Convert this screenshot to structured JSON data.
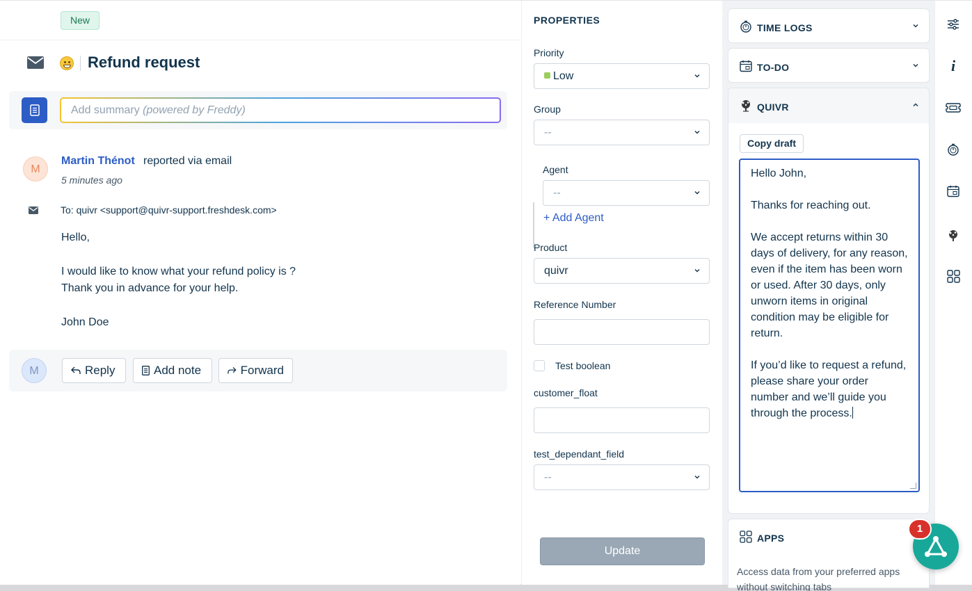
{
  "ticket": {
    "status": "New",
    "title": "Refund request",
    "summary_placeholder": "Add summary",
    "summary_powered": "(powered by Freddy)",
    "sender_initial": "M",
    "sender_name": "Martin Thénot",
    "via_text": "reported via email",
    "time": "5 minutes ago",
    "to_label": "To:",
    "to_value": "quivr <support@quivr-support.freshdesk.com>",
    "body": [
      "Hello,",
      "I would like to know what your refund policy is ?",
      "Thank you in advance for your help.",
      "John Doe"
    ],
    "me_initial": "M",
    "actions": {
      "reply": "Reply",
      "add_note": "Add note",
      "forward": "Forward"
    }
  },
  "properties": {
    "title": "PROPERTIES",
    "priority": {
      "label": "Priority",
      "value": "Low",
      "color": "#9cce5e"
    },
    "group": {
      "label": "Group",
      "value": "--"
    },
    "agent": {
      "label": "Agent",
      "value": "--",
      "add_label": "+ Add Agent"
    },
    "product": {
      "label": "Product",
      "value": "quivr"
    },
    "reference": {
      "label": "Reference Number",
      "value": ""
    },
    "test_boolean": {
      "label": "Test boolean"
    },
    "customer_float": {
      "label": "customer_float",
      "value": ""
    },
    "dependant": {
      "label": "test_dependant_field",
      "value": "--"
    },
    "update_label": "Update"
  },
  "widgets": {
    "time_logs": "TIME LOGS",
    "todo": "TO-DO",
    "quivr": {
      "title": "QUIVR",
      "copy_label": "Copy draft",
      "draft": "Hello John,\n\nThanks for reaching out.\n\nWe accept returns within 30 days of delivery, for any reason, even if the item has been worn or used. After 30 days, only unworn items in original condition may be eligible for return.\n\nIf you’d like to request a refund, please share your order number and we’ll guide you through the process."
    },
    "apps": {
      "title": "APPS",
      "desc": "Access data from your preferred apps without switching tabs"
    }
  },
  "fab_badge": "1",
  "colors": {
    "primary": "#2c5cc5",
    "fab": "#18a89a",
    "badge": "#d8312b"
  }
}
